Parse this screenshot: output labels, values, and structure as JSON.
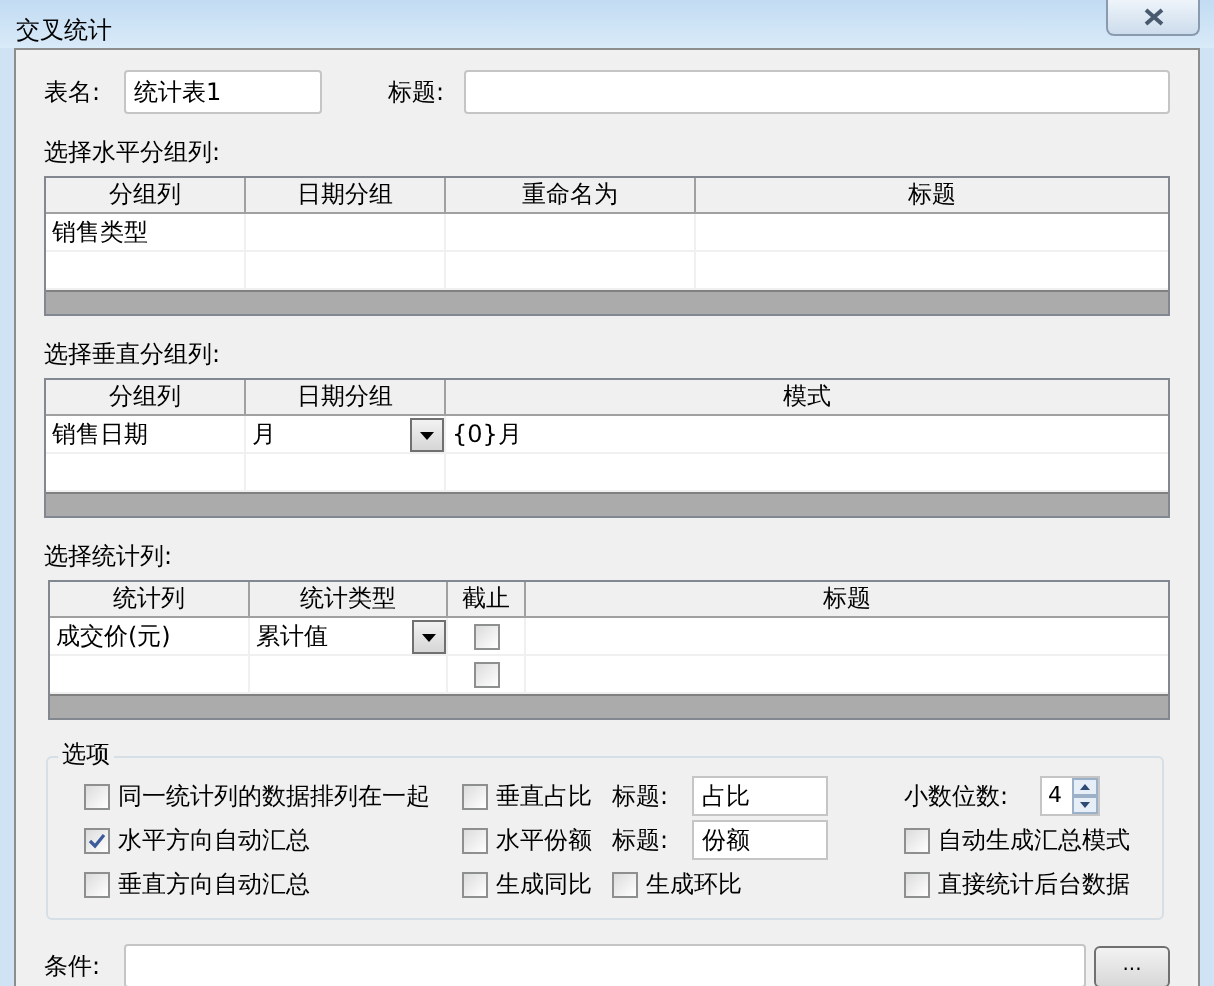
{
  "window": {
    "title": "交叉统计"
  },
  "table_name": {
    "label": "表名:",
    "value": "统计表1"
  },
  "title_field": {
    "label": "标题:"
  },
  "grids": [
    {
      "kind": "grouping",
      "label": "选择水平分组列:",
      "columns": [
        "分组列",
        "日期分组",
        "重命名为",
        "标题"
      ],
      "rows": [
        {
          "group_column": "销售类型"
        }
      ]
    },
    {
      "kind": "pattern",
      "label": "选择垂直分组列:",
      "columns": [
        "分组列",
        "日期分组",
        "模式"
      ],
      "rows": [
        {
          "group_column": "销售日期",
          "date_group": "月",
          "pattern": "{0}月"
        }
      ]
    },
    {
      "kind": "statistics",
      "label": "选择统计列:",
      "columns": [
        "统计列",
        "统计类型",
        "截止",
        "标题"
      ],
      "rows": [
        {
          "stat_column": "成交价(元)",
          "stat_type": "累计值",
          "cutoff": false
        },
        {
          "cutoff": false
        }
      ]
    }
  ],
  "options": {
    "title": "选项",
    "rows": [
      [
        {
          "kind": "checkbox",
          "label": "同一统计列的数据排列在一起",
          "checked": false
        },
        {
          "kind": "checkbox",
          "label": "垂直占比",
          "checked": false
        },
        {
          "kind": "field",
          "label": "标题:",
          "value": "占比"
        },
        {
          "kind": "spin",
          "label": "小数位数:",
          "value": "4"
        }
      ],
      [
        {
          "kind": "checkbox",
          "label": "水平方向自动汇总",
          "checked": true
        },
        {
          "kind": "checkbox",
          "label": "水平份额",
          "checked": false
        },
        {
          "kind": "field",
          "label": "标题:",
          "value": "份额"
        },
        {
          "kind": "checkbox",
          "label": "自动生成汇总模式",
          "checked": false
        }
      ],
      [
        {
          "kind": "checkbox",
          "label": "垂直方向自动汇总",
          "checked": false
        },
        {
          "kind": "checkbox",
          "label": "生成同比",
          "checked": false
        },
        {
          "kind": "checkbox",
          "label": "生成环比",
          "checked": false
        },
        {
          "kind": "checkbox",
          "label": "直接统计后台数据",
          "checked": false
        }
      ]
    ]
  },
  "condition": {
    "label": "条件:",
    "button": "..."
  }
}
